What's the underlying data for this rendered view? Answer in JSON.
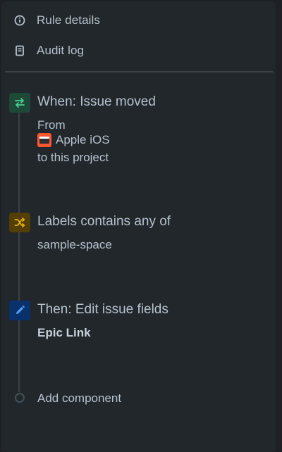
{
  "nav": {
    "rule_details": {
      "label": "Rule details",
      "icon": "info-icon"
    },
    "audit_log": {
      "label": "Audit log",
      "icon": "document-icon"
    }
  },
  "steps": {
    "trigger": {
      "title": "When: Issue moved",
      "from_label": "From",
      "project_name": "Apple iOS",
      "project_icon": "project-avatar-icon",
      "to_label": "to this project",
      "icon": "transfer-arrows-icon",
      "icon_bg": "#1f4937",
      "icon_color": "#4bce97"
    },
    "condition": {
      "title": "Labels contains any of",
      "value": "sample-space",
      "icon": "shuffle-icon",
      "icon_bg": "#533f04",
      "icon_color": "#e2b203"
    },
    "action": {
      "title": "Then: Edit issue fields",
      "value": "Epic Link",
      "icon": "pencil-icon",
      "icon_bg": "#09326c",
      "icon_color": "#579dff"
    }
  },
  "add_component": {
    "label": "Add component"
  },
  "colors": {
    "background": "#1d2125",
    "panel": "#22272b",
    "text": "#b6c2cf",
    "divider": "#3b4148"
  }
}
